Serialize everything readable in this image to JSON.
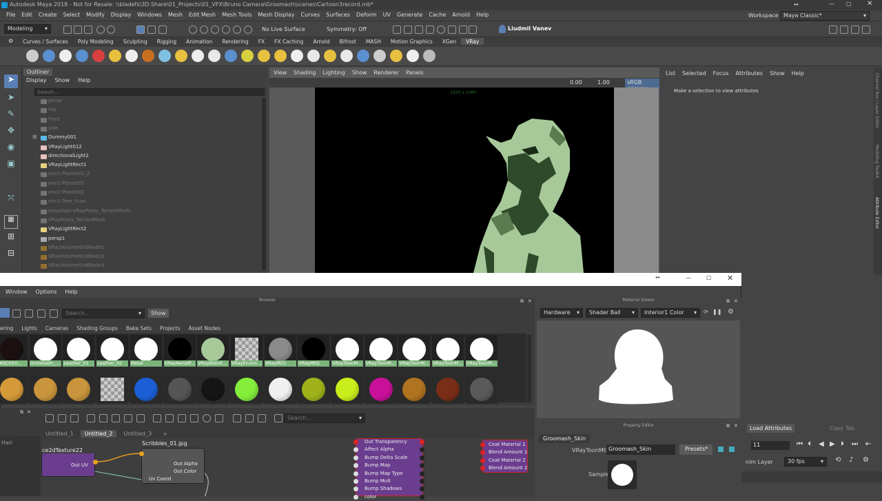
{
  "window": {
    "title": "Autodesk Maya 2018 - Not for Resale: \\\\bladefs\\3D.Share\\01_Projects\\01_VFX\\Bruno Camara\\Groomash\\scenes\\Cartoon3record.mb*"
  },
  "menu": [
    "File",
    "Edit",
    "Create",
    "Select",
    "Modify",
    "Display",
    "Windows",
    "Mesh",
    "Edit Mesh",
    "Mesh Tools",
    "Mesh Display",
    "Curves",
    "Surfaces",
    "Deform",
    "UV",
    "Generate",
    "Cache",
    "Arnold",
    "Help"
  ],
  "workspace": {
    "label": "Workspace :",
    "value": "Maya Classic*"
  },
  "status": {
    "mode": "Modeling",
    "live_surface": "No Live Surface",
    "symmetry": "Symmetry: Off",
    "user": "Liudmil Vanev"
  },
  "shelf_tabs": [
    "Curves / Surfaces",
    "Poly Modeling",
    "Sculpting",
    "Rigging",
    "Animation",
    "Rendering",
    "FX",
    "FX Caching",
    "Arnold",
    "Bifrost",
    "MASH",
    "Motion Graphics",
    "XGen",
    "VRay"
  ],
  "shelf_active": "VRay",
  "outliner": {
    "title": "Outliner",
    "menu": [
      "Display",
      "Show",
      "Help"
    ],
    "search_placeholder": "Search...",
    "items": [
      {
        "label": "persp",
        "dim": true,
        "icon": "camera-icon"
      },
      {
        "label": "top",
        "dim": true,
        "icon": "camera-icon"
      },
      {
        "label": "front",
        "dim": true,
        "icon": "camera-icon"
      },
      {
        "label": "side",
        "dim": true,
        "icon": "camera-icon"
      },
      {
        "label": "Dummy001",
        "dim": false,
        "icon": "dummy-icon",
        "expand": true
      },
      {
        "label": "VRayLight012",
        "dim": false,
        "icon": "light-icon"
      },
      {
        "label": "directionalLight2",
        "dim": false,
        "icon": "light-icon"
      },
      {
        "label": "VRayLightRect1",
        "dim": false,
        "icon": "rect-light-icon"
      },
      {
        "label": "env1:Plane001_2",
        "dim": true,
        "icon": "mesh-icon"
      },
      {
        "label": "env1:Plane001",
        "dim": true,
        "icon": "mesh-icon"
      },
      {
        "label": "env1:Plane002",
        "dim": true,
        "icon": "mesh-icon"
      },
      {
        "label": "env1:Tree_Scan",
        "dim": true,
        "icon": "mesh-icon"
      },
      {
        "label": "mountain:VRayProxy_TerrainMesh",
        "dim": true,
        "icon": "mesh-icon"
      },
      {
        "label": "VRayProxy_TerrainMesh",
        "dim": true,
        "icon": "mesh-icon"
      },
      {
        "label": "VRayLightRect2",
        "dim": false,
        "icon": "rect-light-icon"
      },
      {
        "label": "persp1",
        "dim": false,
        "icon": "camera-icon"
      },
      {
        "label": "VRayVolumeGridNode1",
        "dim": true,
        "icon": "fire-icon"
      },
      {
        "label": "VRayVolumeGridNode2",
        "dim": true,
        "icon": "fire-icon"
      },
      {
        "label": "VRayVolumeGridNode3",
        "dim": true,
        "icon": "fire-icon"
      }
    ]
  },
  "viewport": {
    "menu": [
      "View",
      "Shading",
      "Lighting",
      "Show",
      "Renderer",
      "Panels"
    ],
    "value1": "0.00",
    "value2": "1.00",
    "colorspace": "sRGB gamma",
    "resolution": "1920 x 1080"
  },
  "attr_editor": {
    "menu": [
      "List",
      "Selected",
      "Focus",
      "Attributes",
      "Show",
      "Help"
    ],
    "empty_msg": "Make a selection to view attributes",
    "side_tabs": [
      "Channel Box / Layer Editor",
      "Modeling Toolkit",
      "Attribute Editor"
    ]
  },
  "hypershade": {
    "menu": [
      "Window",
      "Options",
      "Help"
    ],
    "browser_title": "Browser",
    "search_placeholder": "Search...",
    "show_label": "Show",
    "tabs": [
      "ering",
      "Lights",
      "Cameras",
      "Shading Groups",
      "Bake Sets",
      "Projects",
      "Asset Nodes"
    ],
    "row1": [
      {
        "label": "XASC050...",
        "color": "#1a1010"
      },
      {
        "label": "Groomash_...",
        "color": "#ffffff"
      },
      {
        "label": "Leather_01",
        "color": "#ffffff"
      },
      {
        "label": "Leather_02",
        "color": "#ffffff"
      },
      {
        "label": "Metal",
        "color": "#ffffff"
      },
      {
        "label": "VRayAerialP...",
        "color": "#000000"
      },
      {
        "label": "VRayBlend...",
        "color": "#a7c99a"
      },
      {
        "label": "VRayEnviro...",
        "color": "checker"
      },
      {
        "label": "VRayMtl1",
        "color": "#8a8a8a"
      },
      {
        "label": "VRayMtl2",
        "color": "#000000"
      },
      {
        "label": "VRayToonM...",
        "color": "#ffffff"
      },
      {
        "label": "VRayToonM...",
        "color": "#ffffff"
      },
      {
        "label": "VRayToonM...",
        "color": "#ffffff"
      },
      {
        "label": "VRayToonM...",
        "color": "#ffffff"
      },
      {
        "label": "VRayToonM...",
        "color": "#ffffff"
      }
    ],
    "row2": [
      "#d49a3a",
      "#c9953c",
      "#c9953c",
      "checker",
      "#1a5fd6",
      "#555555",
      "#151515",
      "#84ee3a",
      "#f0f0f0",
      "#9fb21a",
      "#c9ee1a",
      "#c8109a",
      "#b0731f",
      "#7a2e18",
      "#5a5a5a"
    ],
    "node_tabs": [
      "Untitled_1",
      "Untitled_2",
      "Untitled_3",
      "+"
    ],
    "node_tab_active": "Untitled_2",
    "node_search_placeholder": "Search...",
    "side_label": "Hair",
    "nodes": {
      "place2d": {
        "title": "ce2dTexture22",
        "out": "Out UV"
      },
      "file": {
        "title": "Scribbles_01.jpg",
        "outs": [
          "Out Alpha",
          "Out Color"
        ],
        "uv": "Uv Coord"
      },
      "vray_attrs": [
        "Out Transparency",
        "Affect Alpha",
        "Bump Delta Scale",
        "Bump Map",
        "Bump Map Type",
        "Bump Mult",
        "Bump Shadows",
        "color"
      ],
      "coat": [
        "Coat Material 1",
        "Blend Amount 1",
        "Coat Material 2",
        "Blend Amount 2"
      ]
    },
    "material_viewer": {
      "title": "Material Viewer",
      "renderer": "Hardware",
      "geometry": "Shader Ball",
      "env": "Interior1 Color"
    },
    "property_editor": {
      "title": "Property Editor",
      "node_tab": "Groomash_Skin",
      "type_label": "VRayToonMtl:",
      "name_value": "Groomash_Skin",
      "presets": "Presets*",
      "sample_label": "Sample"
    }
  },
  "timeline": {
    "load_attrs": "Load Attributes",
    "copy_tab": "Copy Tab",
    "frame": "11",
    "anim_layer": "nim Layer",
    "fps": "30 fps"
  }
}
